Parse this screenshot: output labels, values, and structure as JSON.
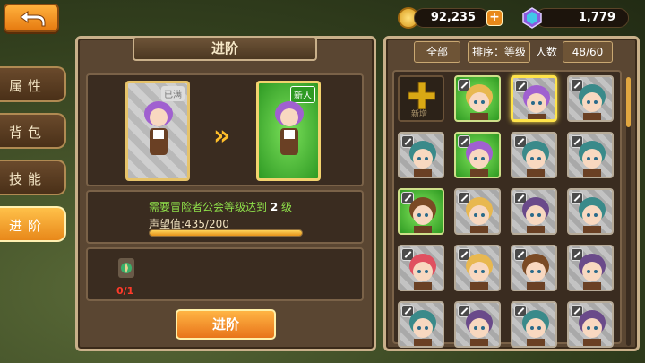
{
  "top_bar": {
    "gold_amount": "92,235",
    "gem_amount": "1,779",
    "add_label": "+"
  },
  "side_tabs": [
    {
      "label": "属性",
      "active": false
    },
    {
      "label": "背包",
      "active": false
    },
    {
      "label": "技能",
      "active": false
    },
    {
      "label": "进阶",
      "active": true
    }
  ],
  "advance_panel": {
    "title": "进阶",
    "requirement_prefix": "需要冒险者公会等级达到",
    "requirement_level": "2",
    "requirement_suffix": "级",
    "reputation_label": "声望值:435/200",
    "reputation_progress": 1.0,
    "current_card_badge": "已满",
    "next_card_badge": "新人",
    "item_count": "0/1",
    "advance_button": "进阶"
  },
  "hero_list": {
    "filter_all": "全部",
    "sort_label": "排序：等级",
    "count_label": "人数",
    "count_value": "48/60",
    "new_slot_label": "新增"
  },
  "colors": {
    "accent_orange": "#e8881a",
    "green_text": "#8fe04a",
    "red_text": "#ff3a2a"
  }
}
